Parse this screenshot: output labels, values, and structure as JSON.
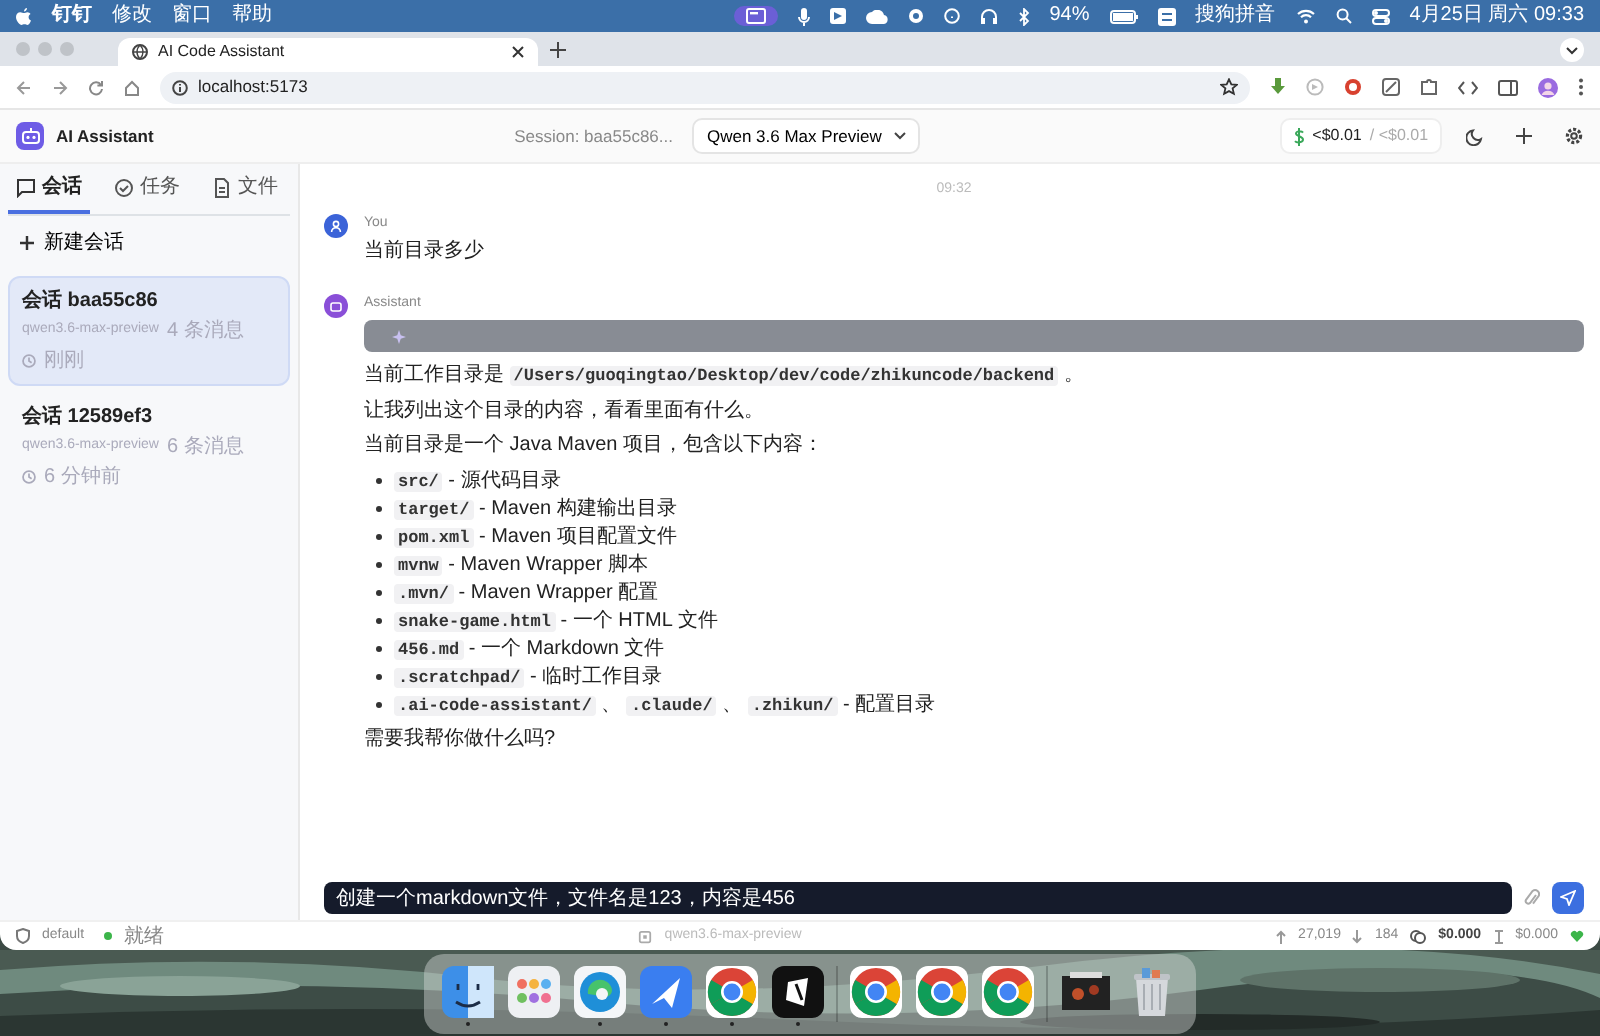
{
  "menubar": {
    "app_menus": [
      "钉钉",
      "修改",
      "窗口",
      "帮助"
    ],
    "battery": "94%",
    "input_method": "搜狗拼音",
    "clock": "4月25日 周六 09:33"
  },
  "browser": {
    "tab_title": "AI Code Assistant",
    "url": "localhost:5173"
  },
  "header": {
    "app_name": "AI Assistant",
    "session": "Session: baa55c86...",
    "model": "Qwen 3.6 Max Preview",
    "cost": "<$0.01",
    "cost_total": "/ <$0.01"
  },
  "sidebar": {
    "tabs": [
      {
        "label": "会话",
        "kind": "chat",
        "selected": true
      },
      {
        "label": "任务",
        "kind": "tasks",
        "selected": false
      },
      {
        "label": "文件",
        "kind": "files",
        "selected": false
      }
    ],
    "new_session": "新建会话",
    "sessions": [
      {
        "title": "会话 baa55c86",
        "model": "qwen3.6-max-preview",
        "count": "4 条消息",
        "time": "刚刚",
        "selected": true
      },
      {
        "title": "会话 12589ef3",
        "model": "qwen3.6-max-preview",
        "count": "6 条消息",
        "time": "6 分钟前",
        "selected": false
      }
    ]
  },
  "chat": {
    "timestamp": "09:32",
    "messages": [
      {
        "kind": "user",
        "author": "You",
        "thinking": false,
        "blocks": [
          {
            "kind": "paragraph",
            "parts": [
              {
                "kind": "text",
                "text": "当前目录多少"
              }
            ]
          }
        ]
      },
      {
        "kind": "assistant",
        "author": "Assistant",
        "thinking": true,
        "blocks": [
          {
            "kind": "paragraph",
            "parts": [
              {
                "kind": "text",
                "text": "当前工作目录是 "
              },
              {
                "kind": "code",
                "text": "/Users/guoqingtao/Desktop/dev/code/zhikuncode/backend"
              },
              {
                "kind": "text",
                "text": " 。"
              }
            ]
          },
          {
            "kind": "paragraph",
            "parts": [
              {
                "kind": "text",
                "text": "让我列出这个目录的内容，看看里面有什么。"
              }
            ]
          },
          {
            "kind": "paragraph",
            "parts": [
              {
                "kind": "text",
                "text": "当前目录是一个 Java Maven 项目，包含以下内容："
              }
            ]
          },
          {
            "kind": "list",
            "items": [
              [
                {
                  "kind": "code",
                  "text": "src/"
                },
                {
                  "kind": "text",
                  "text": " - 源代码目录"
                }
              ],
              [
                {
                  "kind": "code",
                  "text": "target/"
                },
                {
                  "kind": "text",
                  "text": " - Maven 构建输出目录"
                }
              ],
              [
                {
                  "kind": "code",
                  "text": "pom.xml"
                },
                {
                  "kind": "text",
                  "text": " - Maven 项目配置文件"
                }
              ],
              [
                {
                  "kind": "code",
                  "text": "mvnw"
                },
                {
                  "kind": "text",
                  "text": " - Maven Wrapper 脚本"
                }
              ],
              [
                {
                  "kind": "code",
                  "text": ".mvn/"
                },
                {
                  "kind": "text",
                  "text": " - Maven Wrapper 配置"
                }
              ],
              [
                {
                  "kind": "code",
                  "text": "snake-game.html"
                },
                {
                  "kind": "text",
                  "text": " - 一个 HTML 文件"
                }
              ],
              [
                {
                  "kind": "code",
                  "text": "456.md"
                },
                {
                  "kind": "text",
                  "text": " - 一个 Markdown 文件"
                }
              ],
              [
                {
                  "kind": "code",
                  "text": ".scratchpad/"
                },
                {
                  "kind": "text",
                  "text": " - 临时工作目录"
                }
              ],
              [
                {
                  "kind": "code",
                  "text": ".ai-code-assistant/"
                },
                {
                  "kind": "text",
                  "text": " 、 "
                },
                {
                  "kind": "code",
                  "text": ".claude/"
                },
                {
                  "kind": "text",
                  "text": " 、 "
                },
                {
                  "kind": "code",
                  "text": ".zhikun/"
                },
                {
                  "kind": "text",
                  "text": " - 配置目录"
                }
              ]
            ]
          },
          {
            "kind": "paragraph",
            "parts": [
              {
                "kind": "text",
                "text": "需要我帮你做什么吗?"
              }
            ]
          }
        ]
      }
    ]
  },
  "composer": {
    "value": "创建一个markdown文件，文件名是123，内容是456"
  },
  "status_bar": {
    "mode": "default",
    "state": "就绪",
    "model": "qwen3.6-max-preview",
    "tokens_up": "27,019",
    "tokens_down": "184",
    "cost": "$0.000",
    "budget": "$0.000"
  },
  "dock": {
    "apps": [
      {
        "kind": "finder",
        "running": true
      },
      {
        "kind": "launchpad",
        "running": false
      },
      {
        "kind": "edge",
        "running": true
      },
      {
        "kind": "feishu",
        "running": true
      },
      {
        "kind": "chrome",
        "running": true
      },
      {
        "kind": "notes",
        "running": true
      },
      {
        "kind": "separator"
      },
      {
        "kind": "chrome",
        "running": false
      },
      {
        "kind": "chrome",
        "running": false
      },
      {
        "kind": "chrome",
        "running": false
      },
      {
        "kind": "separator"
      },
      {
        "kind": "thumbnail",
        "running": false
      },
      {
        "kind": "trash",
        "running": false
      }
    ]
  }
}
